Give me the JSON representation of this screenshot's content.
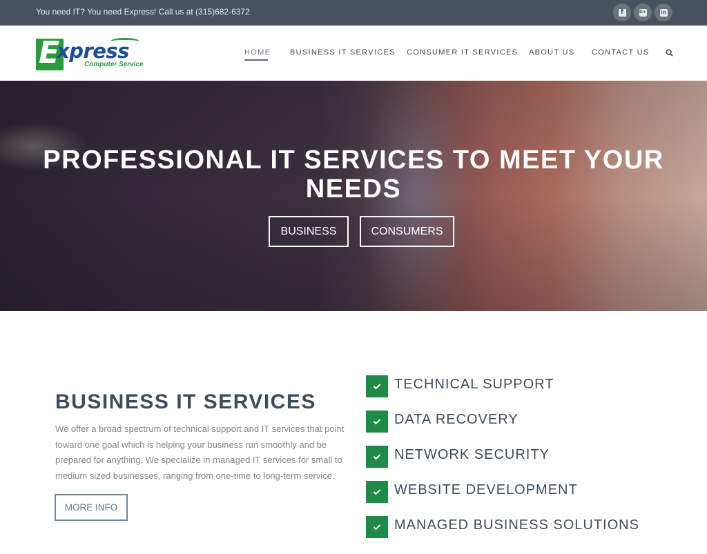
{
  "topbar": {
    "text": "You need IT? You need Express! Call us at (315)682-6372",
    "social": [
      {
        "icon": "facebook-icon",
        "glyph": "f"
      },
      {
        "icon": "google-plus-icon",
        "glyph": "G+"
      },
      {
        "icon": "linkedin-icon",
        "glyph": "in"
      }
    ]
  },
  "logo": {
    "letter": "E",
    "word": "xpress",
    "tagline": "Computer Service"
  },
  "nav": {
    "items": [
      {
        "label": "HOME",
        "active": true
      },
      {
        "label": "BUSINESS IT SERVICES",
        "active": false
      },
      {
        "label": "CONSUMER IT SERVICES",
        "active": false
      },
      {
        "label": "ABOUT US",
        "active": false
      },
      {
        "label": "CONTACT US",
        "active": false
      }
    ],
    "search_icon": "search-icon"
  },
  "hero": {
    "title": "PROFESSIONAL IT SERVICES TO MEET YOUR NEEDS",
    "buttons": [
      "BUSINESS",
      "CONSUMERS"
    ]
  },
  "business": {
    "title": "BUSINESS IT SERVICES",
    "body": "We offer a broad spectrum of technical support and IT services that point toward one goal which is helping your business run smoothly and be prepared for anything. We specialize in managed IT services for small to medium sized businesses, ranging from one-time to long-term service.",
    "more_label": "MORE INFO"
  },
  "services": [
    "TECHNICAL SUPPORT",
    "DATA RECOVERY",
    "NETWORK SECURITY",
    "WEBSITE DEVELOPMENT",
    "MANAGED BUSINESS SOLUTIONS"
  ],
  "colors": {
    "topbar": "#47525d",
    "brand_green": "#1f8a45",
    "brand_blue": "#1d4c9b",
    "heading": "#3e4b59"
  }
}
